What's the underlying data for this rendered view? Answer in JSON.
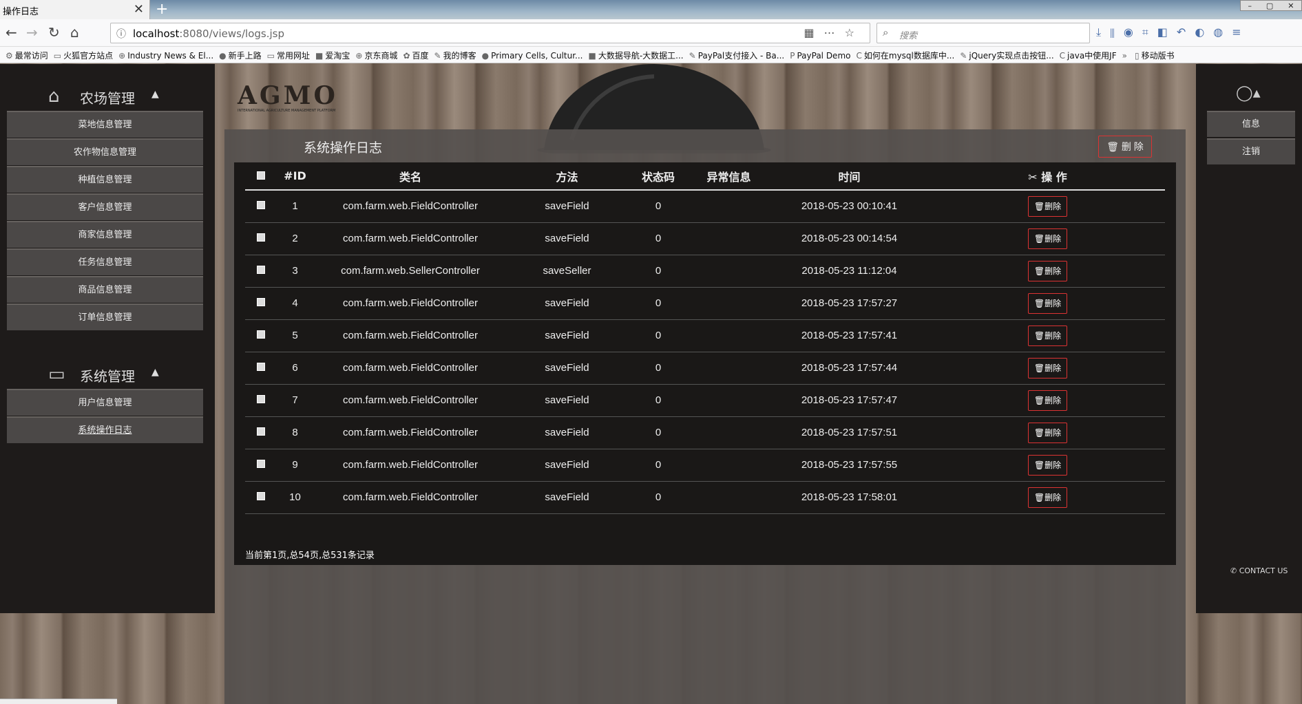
{
  "browser": {
    "tab_title": "操作日志",
    "tab_close": "✕",
    "new_tab": "+",
    "url_prefix": "localhost",
    "url_rest": ":8080/views/logs.jsp",
    "search_placeholder": "搜索",
    "bookmarks": [
      {
        "icon": "⚙",
        "label": "最常访问"
      },
      {
        "icon": "▭",
        "label": "火狐官方站点"
      },
      {
        "icon": "⊕",
        "label": "Industry News & El..."
      },
      {
        "icon": "●",
        "label": "新手上路"
      },
      {
        "icon": "▭",
        "label": "常用网址"
      },
      {
        "icon": "■",
        "label": "爱淘宝"
      },
      {
        "icon": "⊕",
        "label": "京东商城"
      },
      {
        "icon": "✿",
        "label": "百度"
      },
      {
        "icon": "✎",
        "label": "我的博客"
      },
      {
        "icon": "●",
        "label": "Primary Cells, Cultur..."
      },
      {
        "icon": "■",
        "label": "大数据导航-大数据工..."
      },
      {
        "icon": "✎",
        "label": "PayPal支付接入 - Ba..."
      },
      {
        "icon": "P",
        "label": "PayPal Demo"
      },
      {
        "icon": "C",
        "label": "如何在mysql数据库中..."
      },
      {
        "icon": "✎",
        "label": "jQuery实现点击按钮..."
      },
      {
        "icon": "C",
        "label": "java中使用JF"
      },
      {
        "icon": "»",
        "label": ""
      },
      {
        "icon": "▯",
        "label": "移动版书"
      }
    ]
  },
  "sidebar": {
    "farm": {
      "title": "农场管理",
      "items": [
        "菜地信息管理",
        "农作物信息管理",
        "种植信息管理",
        "客户信息管理",
        "商家信息管理",
        "任务信息管理",
        "商品信息管理",
        "订单信息管理"
      ]
    },
    "system": {
      "title": "系统管理",
      "items": [
        "用户信息管理",
        "系统操作日志"
      ]
    }
  },
  "right_menu": {
    "items": [
      "信息",
      "注销"
    ],
    "contact": "CONTACT US"
  },
  "logo": {
    "text": "AGMO",
    "subtitle": "INTERNATIONAL AGRICULTURE MANAGEMENT PLATFORM"
  },
  "panel": {
    "title": "系统操作日志",
    "delete_label": "删 除",
    "columns": [
      "#ID",
      "类名",
      "方法",
      "状态码",
      "异常信息",
      "时间",
      "操 作"
    ],
    "row_delete_label": "删除",
    "rows": [
      {
        "id": "1",
        "class": "com.farm.web.FieldController",
        "method": "saveField",
        "status": "0",
        "error": "",
        "time": "2018-05-23 00:10:41"
      },
      {
        "id": "2",
        "class": "com.farm.web.FieldController",
        "method": "saveField",
        "status": "0",
        "error": "",
        "time": "2018-05-23 00:14:54"
      },
      {
        "id": "3",
        "class": "com.farm.web.SellerController",
        "method": "saveSeller",
        "status": "0",
        "error": "",
        "time": "2018-05-23 11:12:04"
      },
      {
        "id": "4",
        "class": "com.farm.web.FieldController",
        "method": "saveField",
        "status": "0",
        "error": "",
        "time": "2018-05-23 17:57:27"
      },
      {
        "id": "5",
        "class": "com.farm.web.FieldController",
        "method": "saveField",
        "status": "0",
        "error": "",
        "time": "2018-05-23 17:57:41"
      },
      {
        "id": "6",
        "class": "com.farm.web.FieldController",
        "method": "saveField",
        "status": "0",
        "error": "",
        "time": "2018-05-23 17:57:44"
      },
      {
        "id": "7",
        "class": "com.farm.web.FieldController",
        "method": "saveField",
        "status": "0",
        "error": "",
        "time": "2018-05-23 17:57:47"
      },
      {
        "id": "8",
        "class": "com.farm.web.FieldController",
        "method": "saveField",
        "status": "0",
        "error": "",
        "time": "2018-05-23 17:57:51"
      },
      {
        "id": "9",
        "class": "com.farm.web.FieldController",
        "method": "saveField",
        "status": "0",
        "error": "",
        "time": "2018-05-23 17:57:55"
      },
      {
        "id": "10",
        "class": "com.farm.web.FieldController",
        "method": "saveField",
        "status": "0",
        "error": "",
        "time": "2018-05-23 17:58:01"
      }
    ],
    "pager": "当前第1页,总54页,总531条记录"
  },
  "colors": {
    "accent_red": "#dd3333",
    "sidebar_bg": "#1e1b1a",
    "menu_item_bg": "#4b4847"
  }
}
